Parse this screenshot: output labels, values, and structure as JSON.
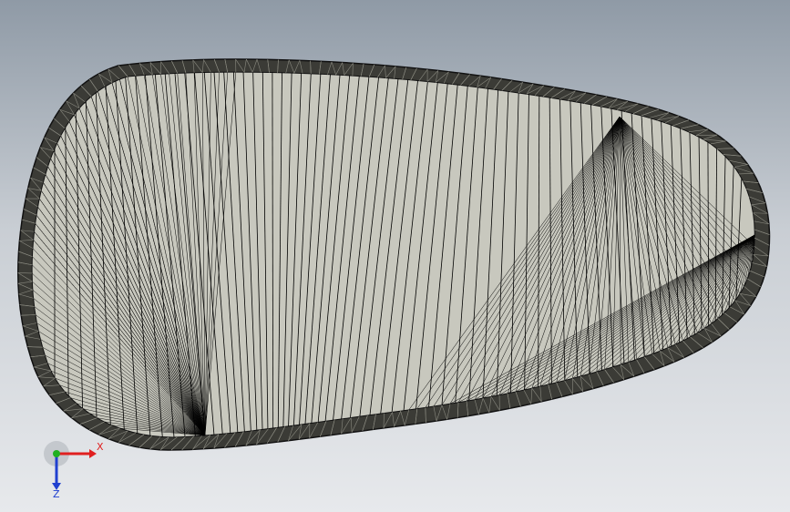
{
  "colors": {
    "background_top": "#8f9aa6",
    "background_bottom": "#e7e9ec",
    "face_fill": "#c8c8be",
    "rim_fill": "#3b3b36",
    "mesh_line": "#000000",
    "axis_x": "#e02020",
    "axis_y": "#20b020",
    "axis_z": "#2040d0"
  },
  "model": {
    "view": "mesh-tessellation",
    "shape": "rounded-wedge-outline"
  },
  "triad": {
    "x_label": "X",
    "z_label": "Z"
  },
  "icons": {
    "triad": "coordinate-triad-icon"
  }
}
